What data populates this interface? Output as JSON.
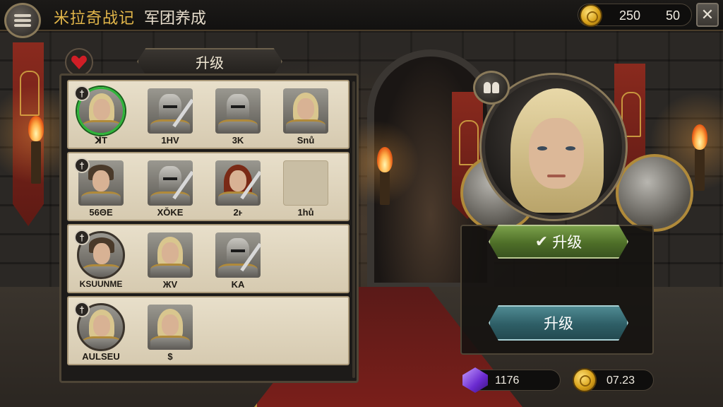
{
  "header": {
    "game_title": "米拉奇战记",
    "screen_title": "军团养成",
    "currency_a": "250",
    "currency_b": "50",
    "close_label": "✕"
  },
  "roster": {
    "tab_label": "升级",
    "rows": [
      {
        "units": [
          {
            "label": "ꓘT",
            "rank": "†"
          },
          {
            "label": "1HV"
          },
          {
            "label": "3K"
          },
          {
            "label": "Snů"
          }
        ]
      },
      {
        "units": [
          {
            "label": "56ΘE",
            "rank": "†"
          },
          {
            "label": "XŎKE"
          },
          {
            "label": "2ⱶ"
          },
          {
            "label": "1hů"
          }
        ]
      },
      {
        "units": [
          {
            "label": "KSUUNME",
            "rank": "†"
          },
          {
            "label": "ЖV"
          },
          {
            "label": "KA"
          }
        ]
      },
      {
        "units": [
          {
            "label": "AULSEU",
            "rank": "†"
          },
          {
            "label": "$"
          }
        ]
      }
    ]
  },
  "hero": {
    "upgrade_primary_label": "升级",
    "upgrade_secondary_label": "升级"
  },
  "resources": {
    "gems": "1176",
    "gold": "07.23"
  },
  "icons": {
    "menu": "menu-icon",
    "heart": "heart-icon",
    "group": "group-icon",
    "coin": "coin-icon",
    "gem": "gem-icon",
    "check": "check-icon"
  }
}
